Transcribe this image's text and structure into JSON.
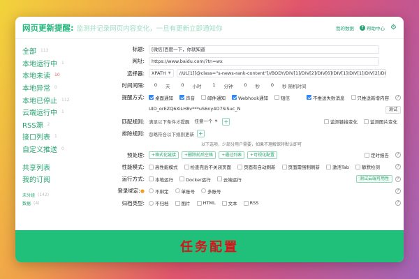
{
  "header": {
    "title": "网页更新提醒:",
    "subtitle": "监测并记录网页内容变化，一旦有更新立即通知你",
    "my_data": "我的数据",
    "help": "帮助中心"
  },
  "sidebar": {
    "items": [
      {
        "label": "全部",
        "count": "113"
      },
      {
        "label": "本地运行中",
        "count": "1"
      },
      {
        "label": "本地未读",
        "count": "10"
      },
      {
        "label": "本地异常",
        "count": "0"
      },
      {
        "label": "本地已停止",
        "count": "112"
      },
      {
        "label": "云端运行中",
        "count": "1"
      },
      {
        "label": "RSS源",
        "count": "2"
      },
      {
        "label": "接口列表",
        "count": "1"
      },
      {
        "label": "自定义推送",
        "count": "0"
      }
    ],
    "links": [
      {
        "label": "共享列表"
      },
      {
        "label": "我的订阅"
      }
    ],
    "groups": [
      {
        "label": "未分组",
        "count": "(142)"
      },
      {
        "label": "数据",
        "count": "(4)"
      }
    ]
  },
  "form": {
    "title": {
      "label": "标题:",
      "value": "[微信]百度一下，你就知道"
    },
    "url": {
      "label": "网址:",
      "value": "https://www.baidu.com/?tn=wx"
    },
    "selector": {
      "label": "选择器:",
      "type": "XPATH",
      "value": "//UL[1][@class=\"s-news-rank-content\"]//BODY/DIV[1]/DIV[2]/DIV[6]/DIV[1]/DIV[1]/DIV[2]/DIV/DIV[1"
    },
    "interval": {
      "label": "时间间隔:",
      "days": "0",
      "days_unit": "天",
      "hours": "0",
      "hours_unit": "小时",
      "minutes": "1",
      "minutes_unit": "分钟",
      "seconds": "0",
      "seconds_unit": "秒",
      "random": "0",
      "random_unit": "秒 随机时间"
    },
    "notify": {
      "label": "提醒方式:",
      "options": [
        {
          "label": "桌面通知",
          "checked": true
        },
        {
          "label": "声音",
          "checked": true
        },
        {
          "label": "邮件通知",
          "checked": false
        },
        {
          "label": "Webhook通知",
          "checked": true
        },
        {
          "label": "短信",
          "checked": false
        }
      ],
      "right_options": [
        {
          "label": "不推送失败消息",
          "checked": true
        },
        {
          "label": "只推送新增内容",
          "checked": false
        }
      ]
    },
    "token": {
      "value": "UID_orEZQ6XiLH8v***uS6ny4O7SiSuc_N",
      "test": "测试"
    },
    "match": {
      "label": "匹配规则:",
      "desc": "满足以下条件才提醒",
      "mode": "任意一个",
      "right": [
        {
          "label": "监测链接变化"
        },
        {
          "label": "监测图片变化"
        }
      ]
    },
    "exclude": {
      "label": "排除规则:",
      "desc": "忽略符合以下规则更新"
    },
    "note": "以下选项，少部分用户需要，如果不理解保持默认即可",
    "preprocess": {
      "label": "预处理:",
      "chips": [
        "+格式化链接",
        "+删除前后空格",
        "+通过列表",
        "+可视化配置"
      ],
      "right": "定时报告"
    },
    "performance": {
      "label": "性能模式:",
      "options": [
        "高性能模式",
        "检查完后不关闭页面",
        "页面有自动刷新",
        "页面需强制刷新",
        "激活Tab",
        "静默检测"
      ]
    },
    "runmode": {
      "label": "运行方式:",
      "options": [
        "本地运行",
        "Docker运行",
        "云端运行"
      ],
      "button": "测试云端可用性"
    },
    "login": {
      "label": "登录绑定:",
      "options": [
        "不绑定",
        "单账号",
        "多账号"
      ]
    },
    "archive": {
      "label": "归档类型:",
      "options": [
        "不归档",
        "图片",
        "HTML",
        "文本",
        "RSS"
      ]
    }
  },
  "banner": {
    "text": "任务配置"
  },
  "colors": {
    "accent": "#27b67d",
    "banner": "#21c07a",
    "banner_text": "#d8141b",
    "checkbox": "#2f86f6"
  }
}
